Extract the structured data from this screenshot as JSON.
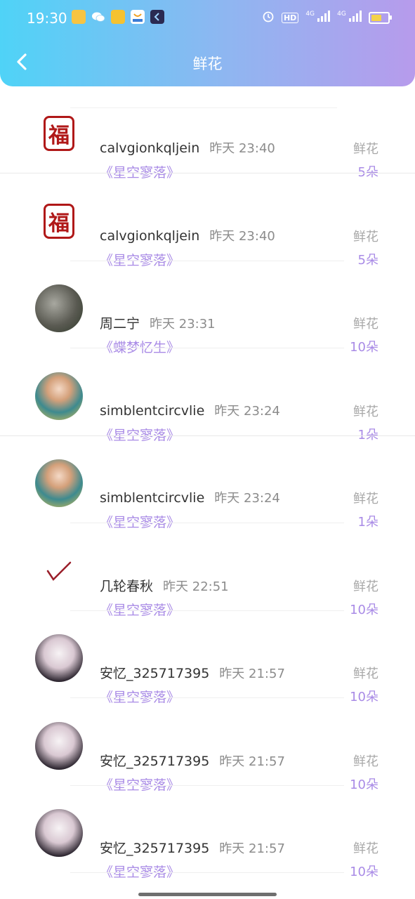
{
  "status_bar": {
    "time": "19:30",
    "app_icons": [
      {
        "name": "mail-app-icon",
        "color": "#f6c442"
      },
      {
        "name": "wechat-app-icon",
        "color": "#ffffff"
      },
      {
        "name": "vip-app-icon",
        "color": "#f5c230"
      },
      {
        "name": "store-app-icon",
        "color": "#ffffff"
      },
      {
        "name": "nav-app-icon",
        "color": "#2a2a52"
      }
    ],
    "hd_label": "HD",
    "network_1": "4G",
    "network_2": "4G",
    "battery_level": 0.65,
    "battery_color": "#f4d24a"
  },
  "header": {
    "title": "鲜花",
    "back_icon": "chevron-left-icon",
    "gradient": [
      "#4fd3f7",
      "#8fb6f1",
      "#b79bec"
    ]
  },
  "records": [
    {
      "name": "calvgionkqljein",
      "time": "昨天 23:40",
      "book": "《星空寥落》",
      "gift": "鲜花",
      "count": "5朵",
      "avatar": "fu-papercut-avatar"
    },
    {
      "name": "calvgionkqljein",
      "time": "昨天 23:40",
      "book": "《星空寥落》",
      "gift": "鲜花",
      "count": "5朵",
      "avatar": "fu-papercut-avatar"
    },
    {
      "name": "周二宁",
      "time": "昨天 23:31",
      "book": "《蝶梦忆生》",
      "gift": "鲜花",
      "count": "10朵",
      "avatar": "cat-photo-avatar"
    },
    {
      "name": "simblentcircvlie",
      "time": "昨天 23:24",
      "book": "《星空寥落》",
      "gift": "鲜花",
      "count": "1朵",
      "avatar": "girl-photo-avatar"
    },
    {
      "name": "simblentcircvlie",
      "time": "昨天 23:24",
      "book": "《星空寥落》",
      "gift": "鲜花",
      "count": "1朵",
      "avatar": "girl-photo-avatar"
    },
    {
      "name": "几轮春秋",
      "time": "昨天 22:51",
      "book": "《星空寥落》",
      "gift": "鲜花",
      "count": "10朵",
      "avatar": "checkmark-avatar"
    },
    {
      "name": "安忆_325717395",
      "time": "昨天 21:57",
      "book": "《星空寥落》",
      "gift": "鲜花",
      "count": "10朵",
      "avatar": "anime-girl-avatar"
    },
    {
      "name": "安忆_325717395",
      "time": "昨天 21:57",
      "book": "《星空寥落》",
      "gift": "鲜花",
      "count": "10朵",
      "avatar": "anime-girl-avatar"
    },
    {
      "name": "安忆_325717395",
      "time": "昨天 21:57",
      "book": "《星空寥落》",
      "gift": "鲜花",
      "count": "10朵",
      "avatar": "anime-girl-avatar"
    }
  ],
  "colors": {
    "accent": "#a98be6",
    "name_text": "#333333",
    "muted_text": "#8c8c8c"
  }
}
